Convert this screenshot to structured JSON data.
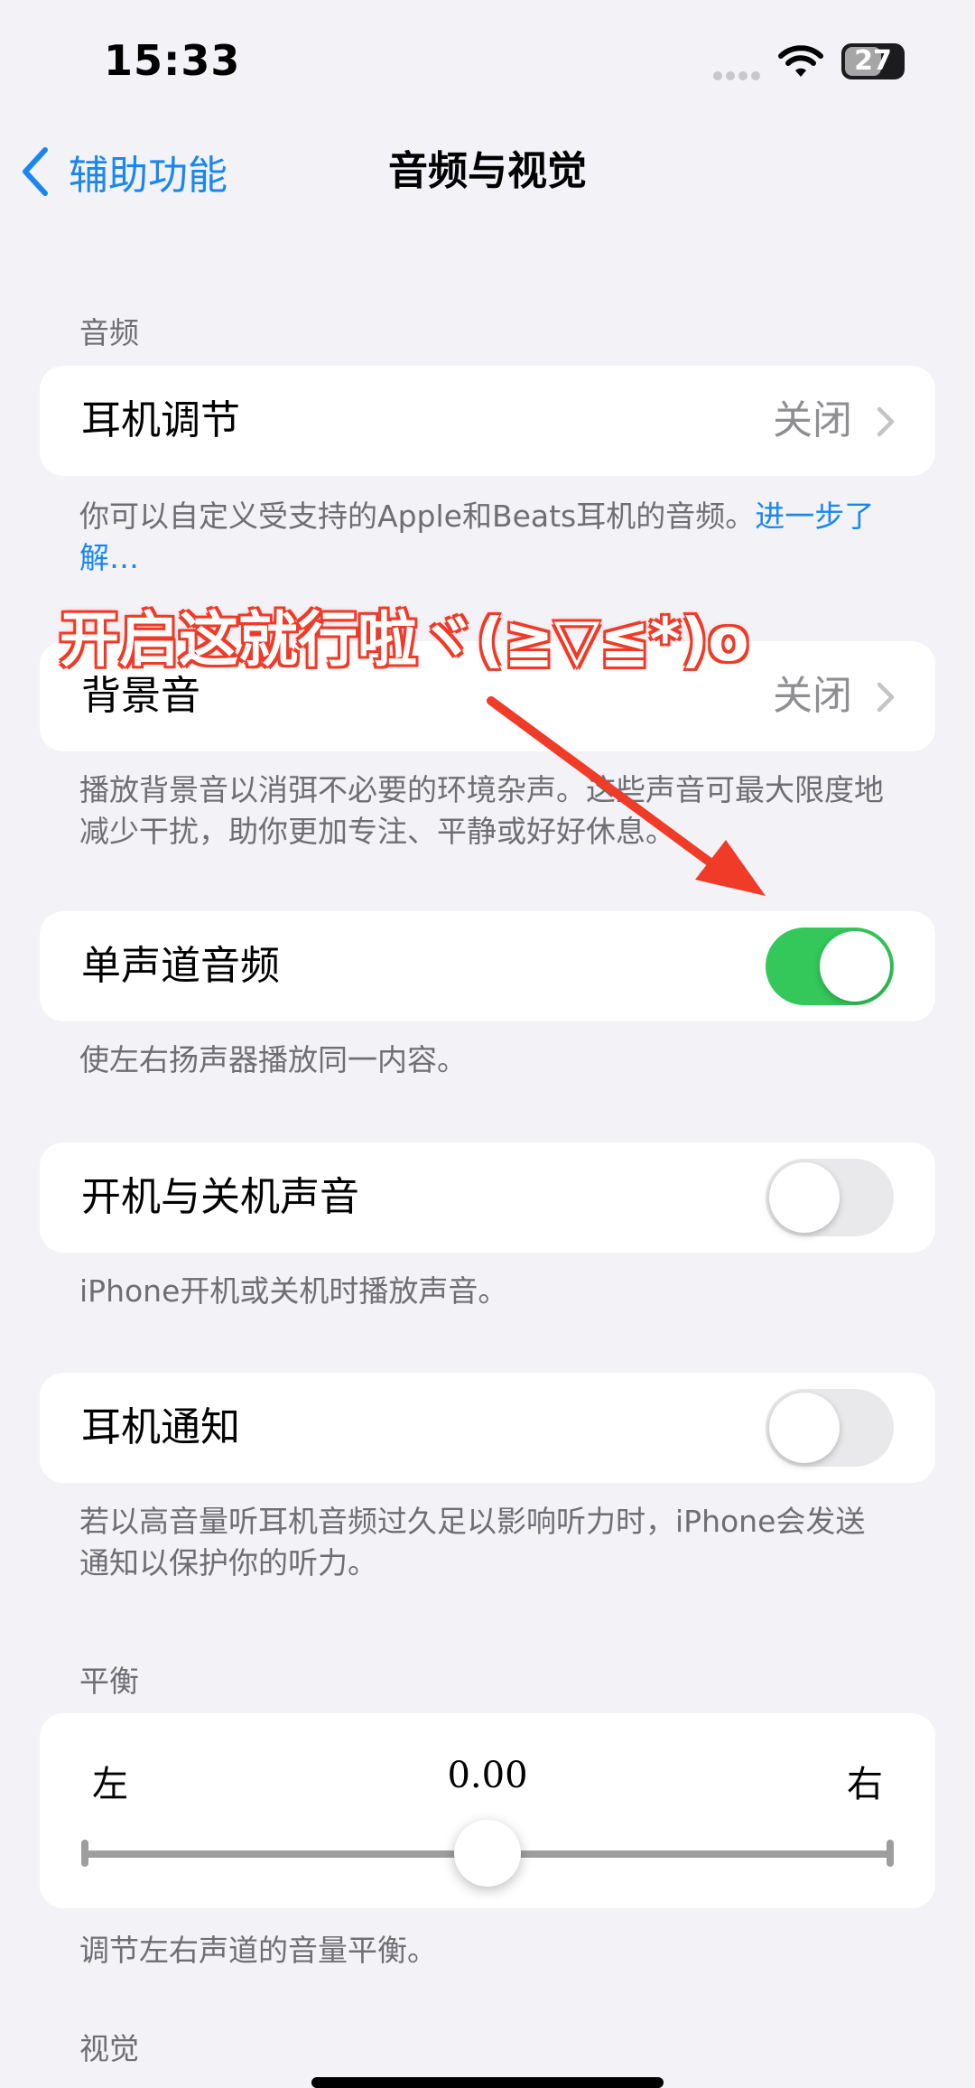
{
  "status_bar": {
    "time": "15:33",
    "battery": "27"
  },
  "nav": {
    "back_label": "辅助功能",
    "title": "音频与视觉"
  },
  "audio": {
    "header": "音频",
    "headphone_accommodations": {
      "label": "耳机调节",
      "value": "关闭"
    },
    "headphone_footer": "你可以自定义受支持的Apple和Beats耳机的音频。",
    "headphone_footer_link": "进一步了解…",
    "background_sounds": {
      "label": "背景音",
      "value": "关闭"
    },
    "background_footer": "播放背景音以消弭不必要的环境杂声。这些声音可最大限度地减少干扰，助你更加专注、平静或好好休息。",
    "mono_audio": {
      "label": "单声道音频",
      "on": true
    },
    "mono_footer": "使左右扬声器播放同一内容。",
    "power_sounds": {
      "label": "开机与关机声音",
      "on": false
    },
    "power_footer": "iPhone开机或关机时播放声音。",
    "headphone_notifications": {
      "label": "耳机通知",
      "on": false
    },
    "notifications_footer": "若以高音量听耳机音频过久足以影响听力时，iPhone会发送通知以保护你的听力。"
  },
  "balance": {
    "header": "平衡",
    "left_label": "左",
    "value": "0.00",
    "right_label": "右",
    "position": 0.5,
    "footer": "调节左右声道的音量平衡。"
  },
  "visual": {
    "header": "视觉"
  },
  "annotation": {
    "text": "开启这就行啦ヾ(≧▽≦*)o",
    "color": "#ef3b28"
  },
  "colors": {
    "accent": "#1a87f0",
    "toggle_on": "#34c759"
  }
}
